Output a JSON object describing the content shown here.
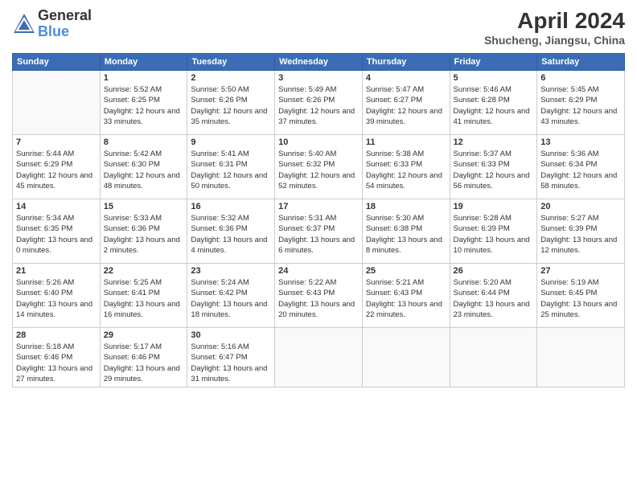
{
  "header": {
    "logo_general": "General",
    "logo_blue": "Blue",
    "title": "April 2024",
    "location": "Shucheng, Jiangsu, China"
  },
  "days_of_week": [
    "Sunday",
    "Monday",
    "Tuesday",
    "Wednesday",
    "Thursday",
    "Friday",
    "Saturday"
  ],
  "weeks": [
    [
      {
        "day": "",
        "info": ""
      },
      {
        "day": "1",
        "sunrise": "Sunrise: 5:52 AM",
        "sunset": "Sunset: 6:25 PM",
        "daylight": "Daylight: 12 hours and 33 minutes."
      },
      {
        "day": "2",
        "sunrise": "Sunrise: 5:50 AM",
        "sunset": "Sunset: 6:26 PM",
        "daylight": "Daylight: 12 hours and 35 minutes."
      },
      {
        "day": "3",
        "sunrise": "Sunrise: 5:49 AM",
        "sunset": "Sunset: 6:26 PM",
        "daylight": "Daylight: 12 hours and 37 minutes."
      },
      {
        "day": "4",
        "sunrise": "Sunrise: 5:47 AM",
        "sunset": "Sunset: 6:27 PM",
        "daylight": "Daylight: 12 hours and 39 minutes."
      },
      {
        "day": "5",
        "sunrise": "Sunrise: 5:46 AM",
        "sunset": "Sunset: 6:28 PM",
        "daylight": "Daylight: 12 hours and 41 minutes."
      },
      {
        "day": "6",
        "sunrise": "Sunrise: 5:45 AM",
        "sunset": "Sunset: 6:29 PM",
        "daylight": "Daylight: 12 hours and 43 minutes."
      }
    ],
    [
      {
        "day": "7",
        "sunrise": "Sunrise: 5:44 AM",
        "sunset": "Sunset: 6:29 PM",
        "daylight": "Daylight: 12 hours and 45 minutes."
      },
      {
        "day": "8",
        "sunrise": "Sunrise: 5:42 AM",
        "sunset": "Sunset: 6:30 PM",
        "daylight": "Daylight: 12 hours and 48 minutes."
      },
      {
        "day": "9",
        "sunrise": "Sunrise: 5:41 AM",
        "sunset": "Sunset: 6:31 PM",
        "daylight": "Daylight: 12 hours and 50 minutes."
      },
      {
        "day": "10",
        "sunrise": "Sunrise: 5:40 AM",
        "sunset": "Sunset: 6:32 PM",
        "daylight": "Daylight: 12 hours and 52 minutes."
      },
      {
        "day": "11",
        "sunrise": "Sunrise: 5:38 AM",
        "sunset": "Sunset: 6:33 PM",
        "daylight": "Daylight: 12 hours and 54 minutes."
      },
      {
        "day": "12",
        "sunrise": "Sunrise: 5:37 AM",
        "sunset": "Sunset: 6:33 PM",
        "daylight": "Daylight: 12 hours and 56 minutes."
      },
      {
        "day": "13",
        "sunrise": "Sunrise: 5:36 AM",
        "sunset": "Sunset: 6:34 PM",
        "daylight": "Daylight: 12 hours and 58 minutes."
      }
    ],
    [
      {
        "day": "14",
        "sunrise": "Sunrise: 5:34 AM",
        "sunset": "Sunset: 6:35 PM",
        "daylight": "Daylight: 13 hours and 0 minutes."
      },
      {
        "day": "15",
        "sunrise": "Sunrise: 5:33 AM",
        "sunset": "Sunset: 6:36 PM",
        "daylight": "Daylight: 13 hours and 2 minutes."
      },
      {
        "day": "16",
        "sunrise": "Sunrise: 5:32 AM",
        "sunset": "Sunset: 6:36 PM",
        "daylight": "Daylight: 13 hours and 4 minutes."
      },
      {
        "day": "17",
        "sunrise": "Sunrise: 5:31 AM",
        "sunset": "Sunset: 6:37 PM",
        "daylight": "Daylight: 13 hours and 6 minutes."
      },
      {
        "day": "18",
        "sunrise": "Sunrise: 5:30 AM",
        "sunset": "Sunset: 6:38 PM",
        "daylight": "Daylight: 13 hours and 8 minutes."
      },
      {
        "day": "19",
        "sunrise": "Sunrise: 5:28 AM",
        "sunset": "Sunset: 6:39 PM",
        "daylight": "Daylight: 13 hours and 10 minutes."
      },
      {
        "day": "20",
        "sunrise": "Sunrise: 5:27 AM",
        "sunset": "Sunset: 6:39 PM",
        "daylight": "Daylight: 13 hours and 12 minutes."
      }
    ],
    [
      {
        "day": "21",
        "sunrise": "Sunrise: 5:26 AM",
        "sunset": "Sunset: 6:40 PM",
        "daylight": "Daylight: 13 hours and 14 minutes."
      },
      {
        "day": "22",
        "sunrise": "Sunrise: 5:25 AM",
        "sunset": "Sunset: 6:41 PM",
        "daylight": "Daylight: 13 hours and 16 minutes."
      },
      {
        "day": "23",
        "sunrise": "Sunrise: 5:24 AM",
        "sunset": "Sunset: 6:42 PM",
        "daylight": "Daylight: 13 hours and 18 minutes."
      },
      {
        "day": "24",
        "sunrise": "Sunrise: 5:22 AM",
        "sunset": "Sunset: 6:43 PM",
        "daylight": "Daylight: 13 hours and 20 minutes."
      },
      {
        "day": "25",
        "sunrise": "Sunrise: 5:21 AM",
        "sunset": "Sunset: 6:43 PM",
        "daylight": "Daylight: 13 hours and 22 minutes."
      },
      {
        "day": "26",
        "sunrise": "Sunrise: 5:20 AM",
        "sunset": "Sunset: 6:44 PM",
        "daylight": "Daylight: 13 hours and 23 minutes."
      },
      {
        "day": "27",
        "sunrise": "Sunrise: 5:19 AM",
        "sunset": "Sunset: 6:45 PM",
        "daylight": "Daylight: 13 hours and 25 minutes."
      }
    ],
    [
      {
        "day": "28",
        "sunrise": "Sunrise: 5:18 AM",
        "sunset": "Sunset: 6:46 PM",
        "daylight": "Daylight: 13 hours and 27 minutes."
      },
      {
        "day": "29",
        "sunrise": "Sunrise: 5:17 AM",
        "sunset": "Sunset: 6:46 PM",
        "daylight": "Daylight: 13 hours and 29 minutes."
      },
      {
        "day": "30",
        "sunrise": "Sunrise: 5:16 AM",
        "sunset": "Sunset: 6:47 PM",
        "daylight": "Daylight: 13 hours and 31 minutes."
      },
      {
        "day": "",
        "info": ""
      },
      {
        "day": "",
        "info": ""
      },
      {
        "day": "",
        "info": ""
      },
      {
        "day": "",
        "info": ""
      }
    ]
  ]
}
